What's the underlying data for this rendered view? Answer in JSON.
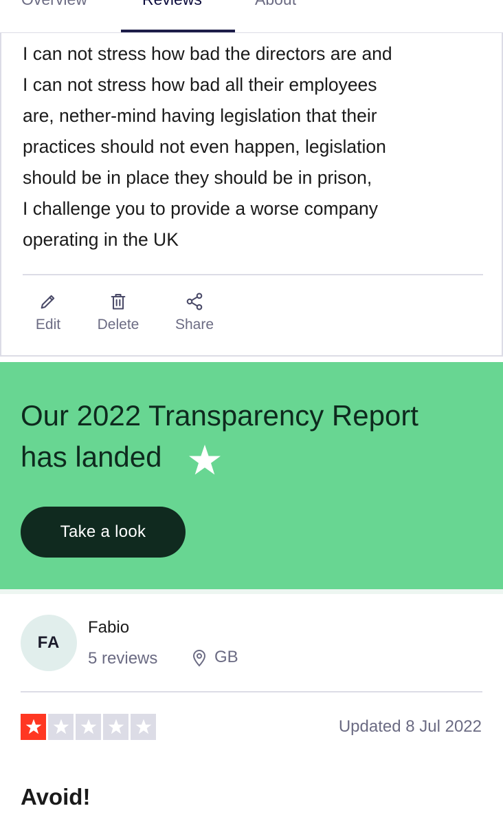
{
  "tabs": [
    {
      "label": "Overview",
      "active": false
    },
    {
      "label": "Reviews",
      "active": true
    },
    {
      "label": "About",
      "active": false
    }
  ],
  "review": {
    "body_lines": [
      "I can not stress how bad the directors are and",
      "I can not stress how bad all their employees",
      "are, nether-mind having legislation that their",
      "practices should not even happen, legislation",
      "should be in place they should be in prison,",
      "I challenge you to provide a worse company",
      "operating in the UK"
    ],
    "actions": [
      {
        "label": "Edit",
        "icon": "pencil-icon"
      },
      {
        "label": "Delete",
        "icon": "trash-icon"
      },
      {
        "label": "Share",
        "icon": "share-icon"
      }
    ]
  },
  "promo": {
    "title_lines": [
      "Our 2022 Transparency Report",
      "has landed"
    ],
    "button_label": "Take a look",
    "background_color": "#68d692",
    "button_color": "#102a1f"
  },
  "next_review": {
    "avatar_initials": "FA",
    "name": "Fabio",
    "reviews_count": "5 reviews",
    "location": "GB",
    "rating": 1,
    "rating_max": 5,
    "updated": "Updated 8 Jul 2022",
    "title": "Avoid!",
    "body_peek": ""
  },
  "colors": {
    "star_on": "#ff3722",
    "star_off": "#dcdce6",
    "muted_text": "#6b6b83"
  }
}
